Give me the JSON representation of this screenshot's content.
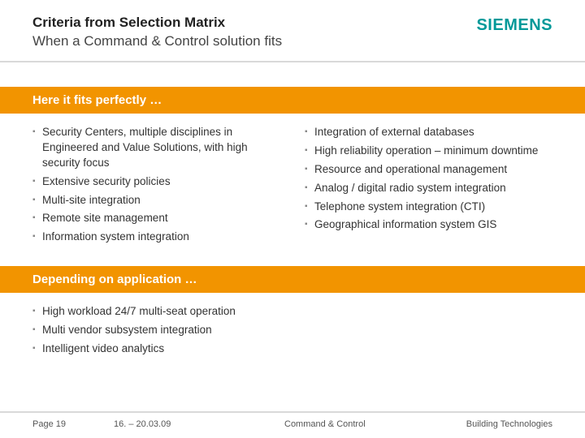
{
  "header": {
    "title": "Criteria from Selection Matrix",
    "subtitle": "When a Command & Control solution fits",
    "logo": "SIEMENS"
  },
  "sections": {
    "fits": {
      "heading": "Here it fits perfectly …",
      "left": [
        "Security Centers, multiple disciplines in Engineered and Value Solutions, with high security focus",
        "Extensive security policies",
        "Multi-site integration",
        "Remote site management",
        "Information system integration"
      ],
      "right": [
        "Integration of external databases",
        "High reliability operation – minimum downtime",
        "Resource and operational management",
        "Analog / digital radio system integration",
        "Telephone system integration (CTI)",
        "Geographical information system GIS"
      ]
    },
    "depending": {
      "heading": "Depending on application …",
      "items": [
        "High workload 24/7 multi-seat operation",
        "Multi vendor subsystem integration",
        "Intelligent video analytics"
      ]
    }
  },
  "footer": {
    "page_label": "Page 19",
    "date": "16. – 20.03.09",
    "center": "Command & Control",
    "right": "Building Technologies"
  }
}
